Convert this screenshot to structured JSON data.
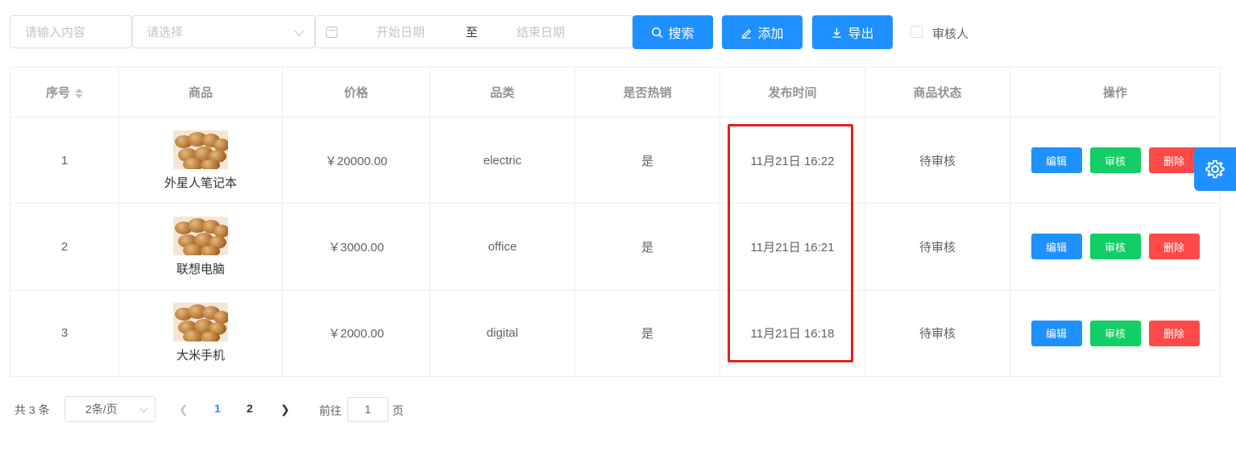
{
  "toolbar": {
    "keyword_placeholder": "请输入内容",
    "select_placeholder": "请选择",
    "date_start_placeholder": "开始日期",
    "date_separator": "至",
    "date_end_placeholder": "结束日期",
    "search_label": "搜索",
    "add_label": "添加",
    "export_label": "导出",
    "reviewer_label": "审核人"
  },
  "table": {
    "columns": [
      "序号",
      "商品",
      "价格",
      "品类",
      "是否热销",
      "发布时间",
      "商品状态",
      "操作"
    ],
    "rows": [
      {
        "index": "1",
        "name": "外星人笔记本",
        "price": "￥20000.00",
        "category": "electric",
        "hot": "是",
        "time": "11月21日 16:22",
        "status": "待审核"
      },
      {
        "index": "2",
        "name": "联想电脑",
        "price": "￥3000.00",
        "category": "office",
        "hot": "是",
        "time": "11月21日 16:21",
        "status": "待审核"
      },
      {
        "index": "3",
        "name": "大米手机",
        "price": "￥2000.00",
        "category": "digital",
        "hot": "是",
        "time": "11月21日 16:18",
        "status": "待审核"
      }
    ],
    "actions": {
      "edit": "编辑",
      "audit": "审核",
      "delete": "删除"
    }
  },
  "pagination": {
    "total": "共 3 条",
    "page_size": "2条/页",
    "pages": [
      "1",
      "2"
    ],
    "current": "1",
    "goto_label": "前往",
    "goto_value": "1",
    "page_suffix": "页"
  },
  "colors": {
    "primary": "#1e90ff",
    "success": "#13ce66",
    "danger": "#ff4949",
    "highlight": "#e02020"
  }
}
